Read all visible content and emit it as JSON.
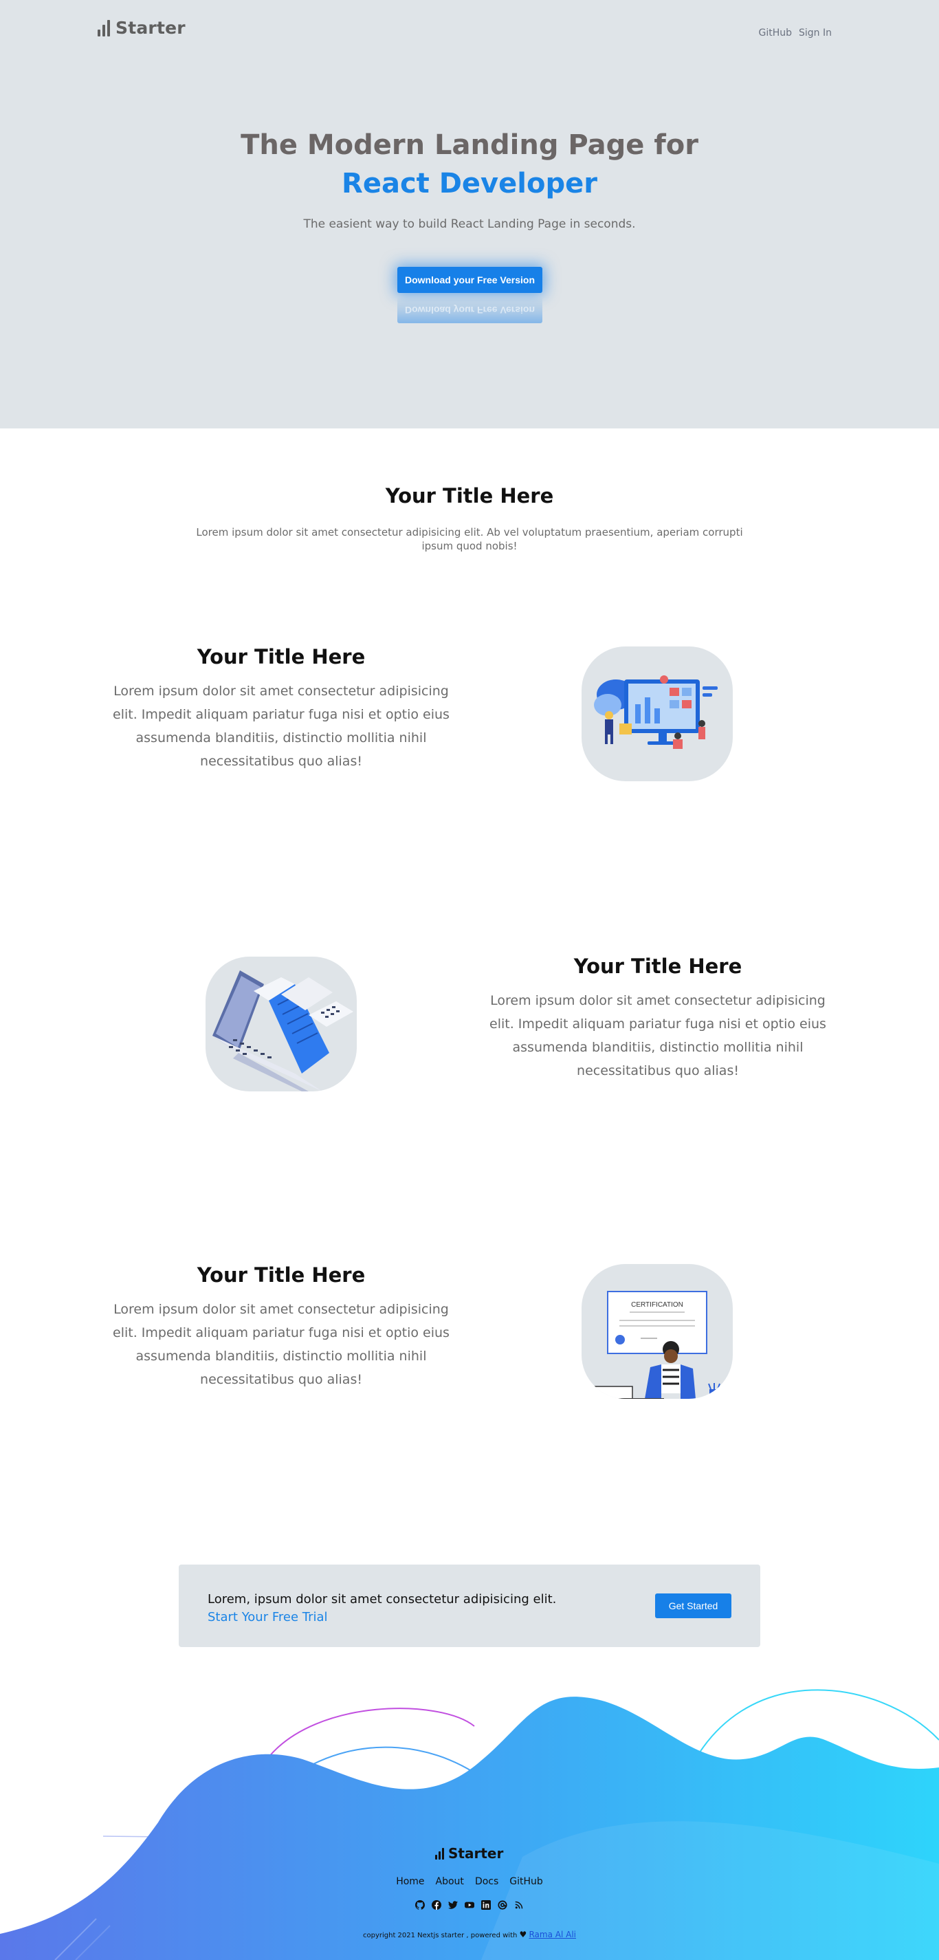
{
  "header": {
    "brand": "Starter",
    "nav": [
      "GitHub",
      "Sign In"
    ]
  },
  "hero": {
    "title_line1": "The Modern Landing Page for",
    "title_line2": "React Developer",
    "subtitle": "The easient way to build React Landing Page in seconds.",
    "cta_label": "Download your Free Version"
  },
  "intro": {
    "title": "Your Title Here",
    "text": "Lorem ipsum dolor sit amet consectetur adipisicing elit. Ab vel voluptatum praesentium, aperiam corrupti ipsum quod nobis!"
  },
  "features": [
    {
      "title": "Your Title Here",
      "body": "Lorem ipsum dolor sit amet consectetur adipisicing elit. Impedit aliquam pariatur fuga nisi et optio eius assumenda blanditiis, distinctio mollitia nihil necessitatibus quo alias!",
      "image": "dashboard-team-illustration"
    },
    {
      "title": "Your Title Here",
      "body": "Lorem ipsum dolor sit amet consectetur adipisicing elit. Impedit aliquam pariatur fuga nisi et optio eius assumenda blanditiis, distinctio mollitia nihil necessitatibus quo alias!",
      "image": "laptop-receipt-illustration"
    },
    {
      "title": "Your Title Here",
      "body": "Lorem ipsum dolor sit amet consectetur adipisicing elit. Impedit aliquam pariatur fuga nisi et optio eius assumenda blanditiis, distinctio mollitia nihil necessitatibus quo alias!",
      "image": "certification-illustration",
      "certificate_text": "CERTIFICATION"
    }
  ],
  "cta_box": {
    "text": "Lorem, ipsum dolor sit amet consectetur adipisicing elit.",
    "link": "Start Your Free Trial",
    "button": "Get Started"
  },
  "footer": {
    "brand": "Starter",
    "nav": [
      "Home",
      "About",
      "Docs",
      "GitHub"
    ],
    "social_icons": [
      "github-icon",
      "facebook-icon",
      "twitter-icon",
      "youtube-icon",
      "linkedin-icon",
      "email-icon",
      "rss-icon"
    ],
    "copyright_prefix": "copyright 2021 Nextjs starter , powered with",
    "author": "Rama Al Ali"
  },
  "colors": {
    "accent": "#1780e8",
    "hero_bg": "#dfe4e8",
    "wave_start": "#5a78ea",
    "wave_end": "#2ed4fb"
  }
}
